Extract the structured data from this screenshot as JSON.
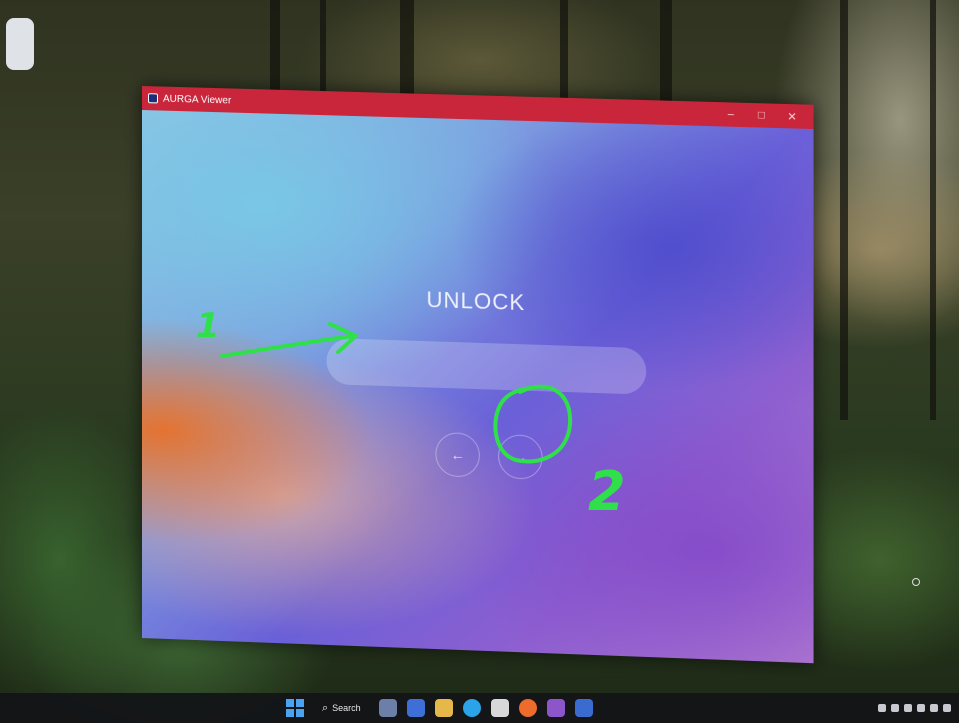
{
  "window": {
    "title": "AURGA Viewer",
    "controls": {
      "minimize": "–",
      "maximize": "□",
      "close": "✕"
    }
  },
  "unlock": {
    "title": "UNLOCK",
    "password": {
      "value": "",
      "placeholder": ""
    },
    "back_icon": "←",
    "next_icon": "→"
  },
  "annotations": {
    "step1": "1",
    "step2": "2",
    "color": "#2fe04a"
  },
  "taskbar": {
    "search_label": "Search",
    "search_icon": "⌕"
  },
  "colors": {
    "titlebar": "#c9263b",
    "annotation": "#2fe04a"
  }
}
